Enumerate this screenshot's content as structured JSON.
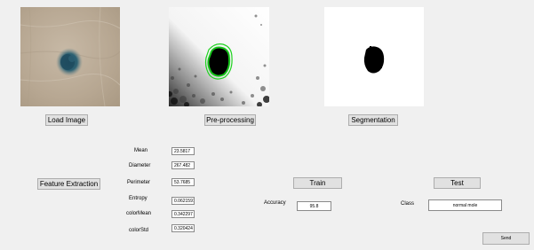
{
  "window": {
    "background": "#f0f0f0"
  },
  "images": {
    "original_icon": "skin-lesion-photo",
    "preprocessed_icon": "preprocessed-lesion-image",
    "segmented_icon": "segmented-lesion-mask"
  },
  "buttons": {
    "load_image": "Load Image",
    "preprocessing": "Pre-processing",
    "segmentation": "Segmentation",
    "feature_extraction": "Feature Extraction",
    "train": "Train",
    "test": "Test",
    "send": "Send"
  },
  "features": [
    {
      "label": "Mean",
      "value": "23.5817"
    },
    {
      "label": "Diameter",
      "value": "267.482"
    },
    {
      "label": "Perimeter",
      "value": "53.7685"
    },
    {
      "label": "Entropy",
      "value": "0.0621591"
    },
    {
      "label": "colorMean",
      "value": "0.342297"
    },
    {
      "label": "colorStd",
      "value": "0.320424"
    }
  ],
  "accuracy": {
    "label": "Accuracy",
    "value": "95.8"
  },
  "class": {
    "label": "Class",
    "value": "normal mole"
  }
}
